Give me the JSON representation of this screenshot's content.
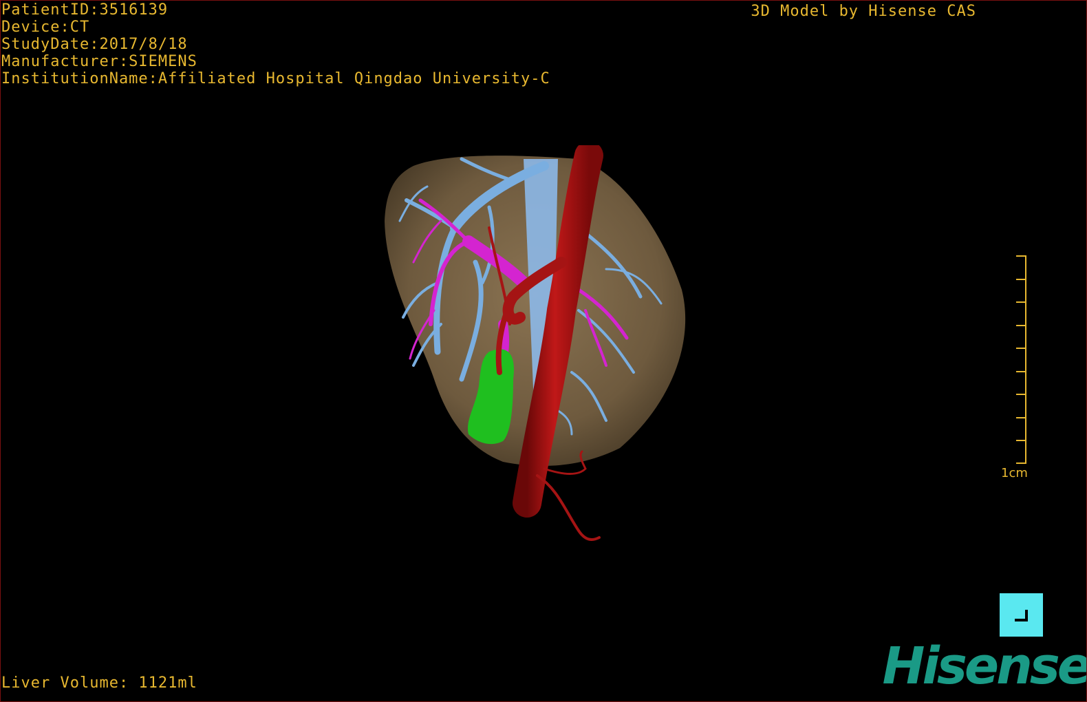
{
  "header": {
    "patient_id": "PatientID:3516139",
    "device": "Device:CT",
    "study_date": "StudyDate:2017/8/18",
    "manufacturer": "Manufacturer:SIEMENS",
    "institution": "InstitutionName:Affiliated Hospital Qingdao University-C"
  },
  "credit": "3D Model by Hisense CAS",
  "footer": {
    "liver_volume": "Liver Volume: 1121ml"
  },
  "scale": {
    "label": "1cm"
  },
  "logo": {
    "text": "Hisense"
  },
  "colors": {
    "text": "#e8b830",
    "liver": "#6e5a3e",
    "portal_vein": "#7aaee0",
    "hepatic_vein": "#d424d0",
    "artery": "#a51414",
    "lesion": "#1fbf1f",
    "button": "#5ae8f0",
    "logo": "#1a9a86"
  },
  "icons": {
    "corner_button": "corner-bracket-icon"
  }
}
